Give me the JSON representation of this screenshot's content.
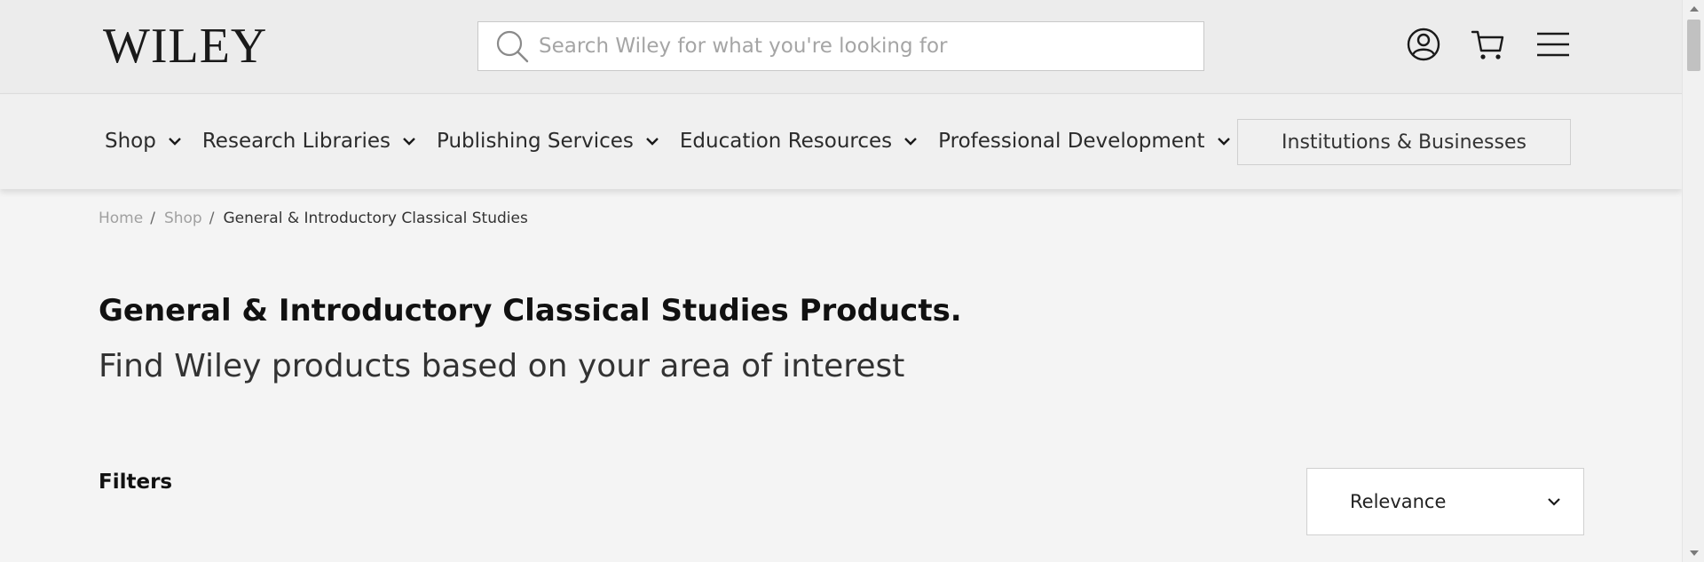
{
  "header": {
    "logo_text": "WILEY",
    "search_placeholder": "Search Wiley for what you're looking for",
    "icons": [
      "account-icon",
      "cart-icon",
      "menu-icon"
    ]
  },
  "nav": {
    "items": [
      {
        "label": "Shop"
      },
      {
        "label": "Research Libraries"
      },
      {
        "label": "Publishing Services"
      },
      {
        "label": "Education Resources"
      },
      {
        "label": "Professional Development"
      }
    ],
    "institutions_label": "Institutions & Businesses"
  },
  "breadcrumb": {
    "home": "Home",
    "shop": "Shop",
    "current": "General & Introductory Classical Studies",
    "separator": "/"
  },
  "page": {
    "title": "General & Introductory Classical Studies Products.",
    "subtitle": "Find Wiley products based on your area of interest"
  },
  "filters": {
    "label": "Filters"
  },
  "sort": {
    "selected": "Relevance"
  },
  "colors": {
    "header_bg": "#ececec",
    "nav_bg": "#f0f0f0",
    "page_bg": "#f4f4f4"
  }
}
